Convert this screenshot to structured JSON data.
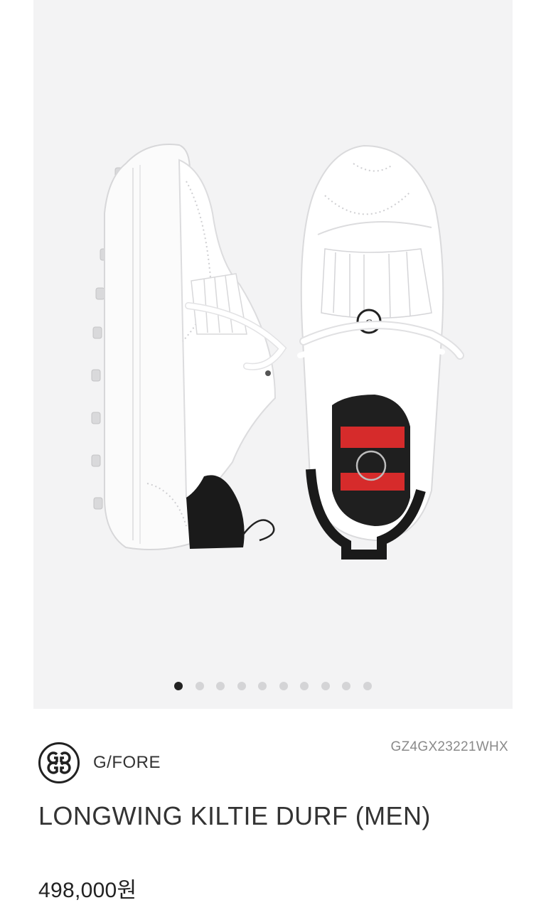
{
  "gallery": {
    "slide_count": 10,
    "active_index": 0,
    "image_alt": "LONGWING KILTIE DURF (MEN)"
  },
  "product": {
    "brand": "G/FORE",
    "sku": "GZ4GX23221WHX",
    "title": "LONGWING KILTIE DURF (MEN)",
    "price": "498,000원"
  },
  "icons": {
    "brand_logo": "gfore-logo-icon",
    "carousel_dot": "dot-icon"
  },
  "colors": {
    "gallery_bg": "#f3f3f4",
    "dot_active": "#222222",
    "dot_inactive": "#d4d4d6",
    "sku_text": "#8a8a8a",
    "insole_red": "#d62b2b",
    "heel_black": "#1a1a1a"
  }
}
